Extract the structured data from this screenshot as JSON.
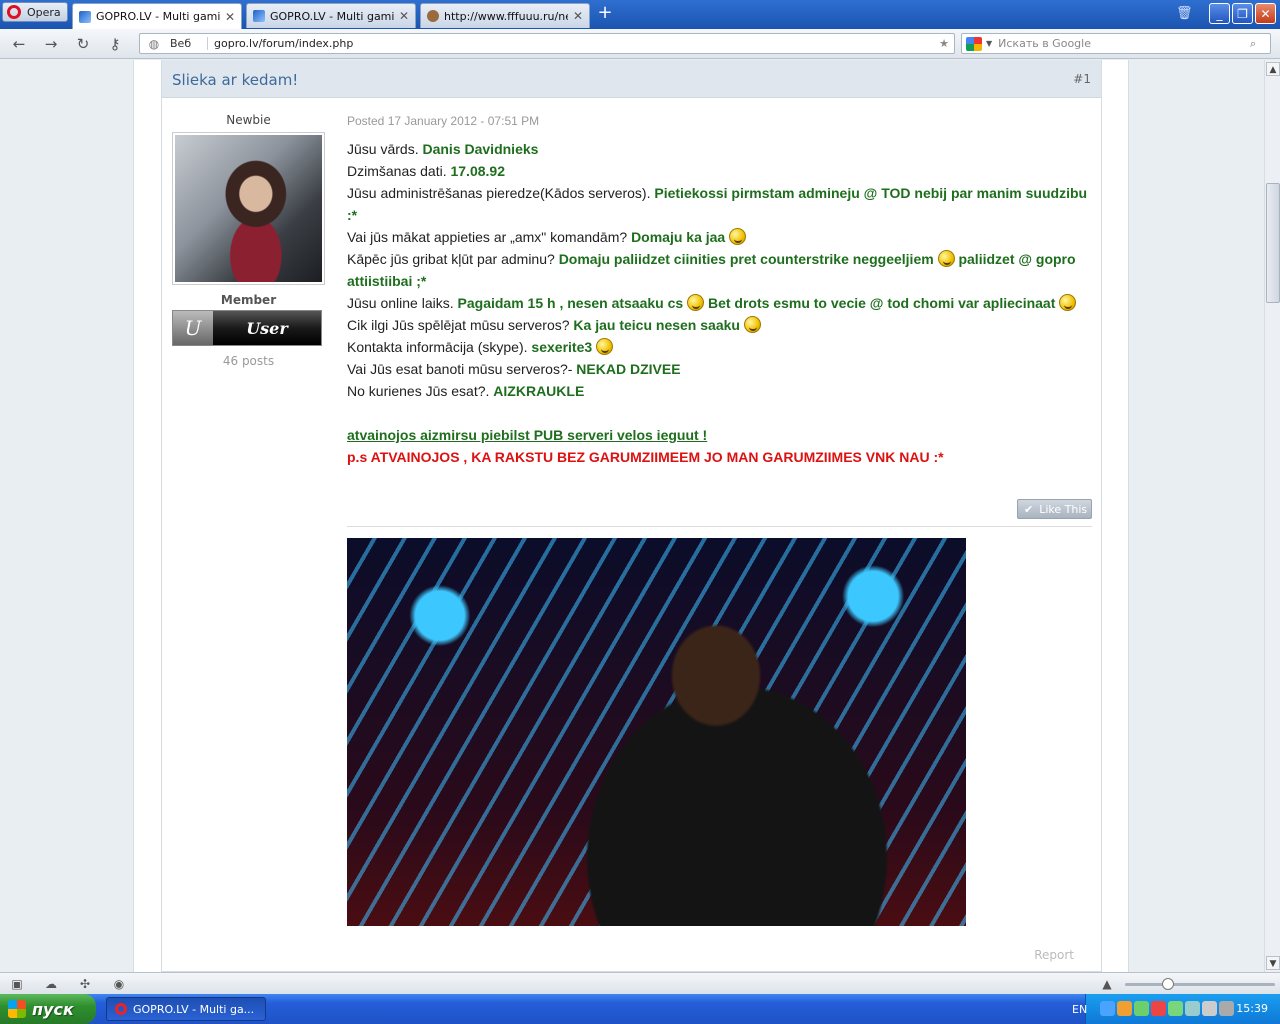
{
  "browser": {
    "menu_label": "Opera",
    "tabs": [
      {
        "title": "GOPRO.LV - Multi gaming...",
        "active": true
      },
      {
        "title": "GOPRO.LV - Multi gaming...",
        "active": false
      },
      {
        "title": "http://www.fffuuu.ru/ne...",
        "active": false
      }
    ],
    "address": {
      "scheme_label": "Веб",
      "url": "gopro.lv/forum/index.php"
    },
    "search_placeholder": "Искать в Google"
  },
  "post": {
    "title": "Slieka ar kedam!",
    "number": "#1",
    "author": {
      "rank": "Newbie",
      "group": "Member",
      "badge_letter": "U",
      "badge_text": "User",
      "post_count": "46 posts"
    },
    "posted": "Posted 17 January 2012 - 07:51 PM",
    "lines": [
      {
        "q": "Jūsu vārds.",
        "a": "Danis Davidnieks"
      },
      {
        "q": "Dzimšanas dati.",
        "a": "17.08.92"
      },
      {
        "q": "Jūsu administrēšanas pieredze(Kādos serveros).",
        "a": "Pietiekossi pirmstam admineju @ TOD nebij par manim suudzibu :*"
      },
      {
        "q": "Vai jūs mākat appieties ar „amx\" komandām?",
        "a": "Domaju ka jaa"
      },
      {
        "q": "Kāpēc jūs gribat kļūt par adminu?",
        "a": "Domaju paliidzet ciinities pret counterstrike neggeeljiem",
        "a2": "paliidzet @ gopro attiistiibai ;*"
      },
      {
        "q": "Jūsu online laiks.",
        "a": "Pagaidam 15 h , nesen atsaaku cs",
        "a2": "Bet drots esmu to vecie @ tod chomi var apliecinaat"
      },
      {
        "q": "Cik ilgi Jūs spēlējat mūsu serveros?",
        "a": "Ka jau teicu nesen saaku"
      },
      {
        "q": "Kontakta informācija (skype).",
        "a": "sexerite3"
      },
      {
        "q": "Vai Jūs esat banoti mūsu serveros?-",
        "a": "NEKAD DZIVEE"
      },
      {
        "q": "No kurienes Jūs esat?.",
        "a": "AIZKRAUKLE"
      }
    ],
    "footnote_link": "atvainojos aizmirsu piebilst PUB serveri velos ieguut !",
    "footnote_red": "p.s ATVAINOJOS , KA RAKSTU BEZ GARUMZIIMEEM JO MAN GARUMZIIMES VNK NAU :*",
    "like_label": "Like This",
    "report_label": "Report"
  },
  "taskbar": {
    "start_label": "пуск",
    "task_title": "GOPRO.LV - Multi ga...",
    "lang": "EN",
    "clock": "15:39"
  }
}
